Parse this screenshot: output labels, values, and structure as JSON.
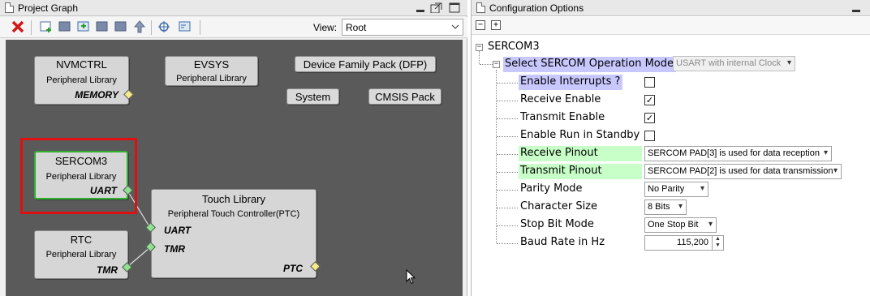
{
  "left_panel": {
    "title": "Project Graph",
    "view_label": "View:",
    "view_value": "Root",
    "toolbar_icons": [
      "delete-icon",
      "new-node-icon",
      "grid-icon",
      "add-library-icon",
      "grid2-icon",
      "grid3-icon",
      "arrow-up-icon",
      "target-icon",
      "layout-icon"
    ]
  },
  "graph": {
    "nvmctrl": {
      "title": "NVMCTRL",
      "subtitle": "Peripheral Library",
      "port": "MEMORY"
    },
    "evsys": {
      "title": "EVSYS",
      "subtitle": "Peripheral Library"
    },
    "dfp": {
      "label": "Device Family Pack (DFP)"
    },
    "system": {
      "label": "System"
    },
    "cmsis": {
      "label": "CMSIS Pack"
    },
    "sercom3": {
      "title": "SERCOM3",
      "subtitle": "Peripheral Library",
      "port": "UART"
    },
    "rtc": {
      "title": "RTC",
      "subtitle": "Peripheral Library",
      "port": "TMR"
    },
    "touch": {
      "title": "Touch Library",
      "subtitle": "Peripheral Touch Controller(PTC)",
      "port_uart": "UART",
      "port_tmr": "TMR",
      "port_ptc": "PTC"
    }
  },
  "right_panel": {
    "title": "Configuration Options",
    "root": "SERCOM3",
    "items": [
      {
        "label": "Select SERCOM Operation Mode",
        "combo": "USART with internal Clock"
      },
      {
        "label": "Enable Interrupts ?",
        "checked": false
      },
      {
        "label": "Receive Enable",
        "checked": true
      },
      {
        "label": "Transmit Enable",
        "checked": true
      },
      {
        "label": "Enable Run in Standby",
        "checked": false
      },
      {
        "label": "Receive Pinout",
        "combo": "SERCOM PAD[3] is used for data reception"
      },
      {
        "label": "Transmit Pinout",
        "combo": "SERCOM PAD[2] is used for data transmission"
      },
      {
        "label": "Parity Mode",
        "combo": "No Parity"
      },
      {
        "label": "Character Size",
        "combo": "8 Bits"
      },
      {
        "label": "Stop Bit Mode",
        "combo": "One Stop Bit"
      },
      {
        "label": "Baud Rate in Hz",
        "value": "115,200"
      }
    ]
  },
  "colors": {
    "canvas": "#5a5a5a",
    "highlight_lavender": "#c8c8ff",
    "highlight_green": "#c8ffc8",
    "selection_red": "#e01010"
  }
}
